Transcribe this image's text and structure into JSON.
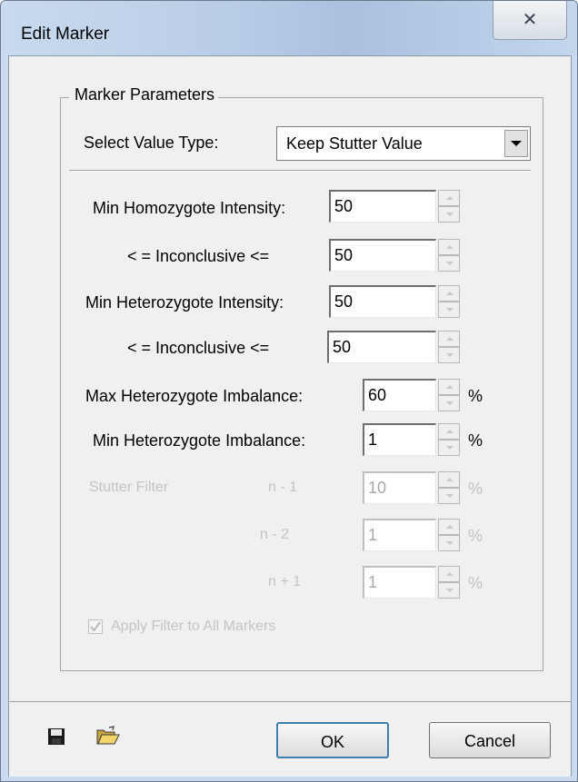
{
  "window": {
    "title": "Edit Marker",
    "close_glyph": "✕"
  },
  "group": {
    "label": "Marker Parameters"
  },
  "value_type": {
    "label": "Select Value Type:",
    "selected": "Keep Stutter Value"
  },
  "fields": [
    {
      "label": "Min Homozygote Intensity:",
      "value": "50",
      "unit": ""
    },
    {
      "label": "< =  Inconclusive  <=",
      "value": "50",
      "unit": ""
    },
    {
      "label": "Min Heterozygote Intensity:",
      "value": "50",
      "unit": ""
    },
    {
      "label": "< =  Inconclusive  <=",
      "value": "50",
      "unit": ""
    },
    {
      "label": "Max Heterozygote Imbalance:",
      "value": "60",
      "unit": "%"
    },
    {
      "label": "Min Heterozygote Imbalance:",
      "value": "1",
      "unit": "%"
    }
  ],
  "stutter": {
    "label": "Stutter Filter",
    "rows": [
      {
        "label": "n - 1",
        "value": "10",
        "unit": "%"
      },
      {
        "label": "n - 2",
        "value": "1",
        "unit": "%"
      },
      {
        "label": "n + 1",
        "value": "1",
        "unit": "%"
      }
    ]
  },
  "apply_all": {
    "label": "Apply Filter to All Markers",
    "checked": true
  },
  "buttons": {
    "ok": "OK",
    "cancel": "Cancel"
  },
  "icons": {
    "save": "save-icon",
    "open": "open-folder-icon"
  }
}
